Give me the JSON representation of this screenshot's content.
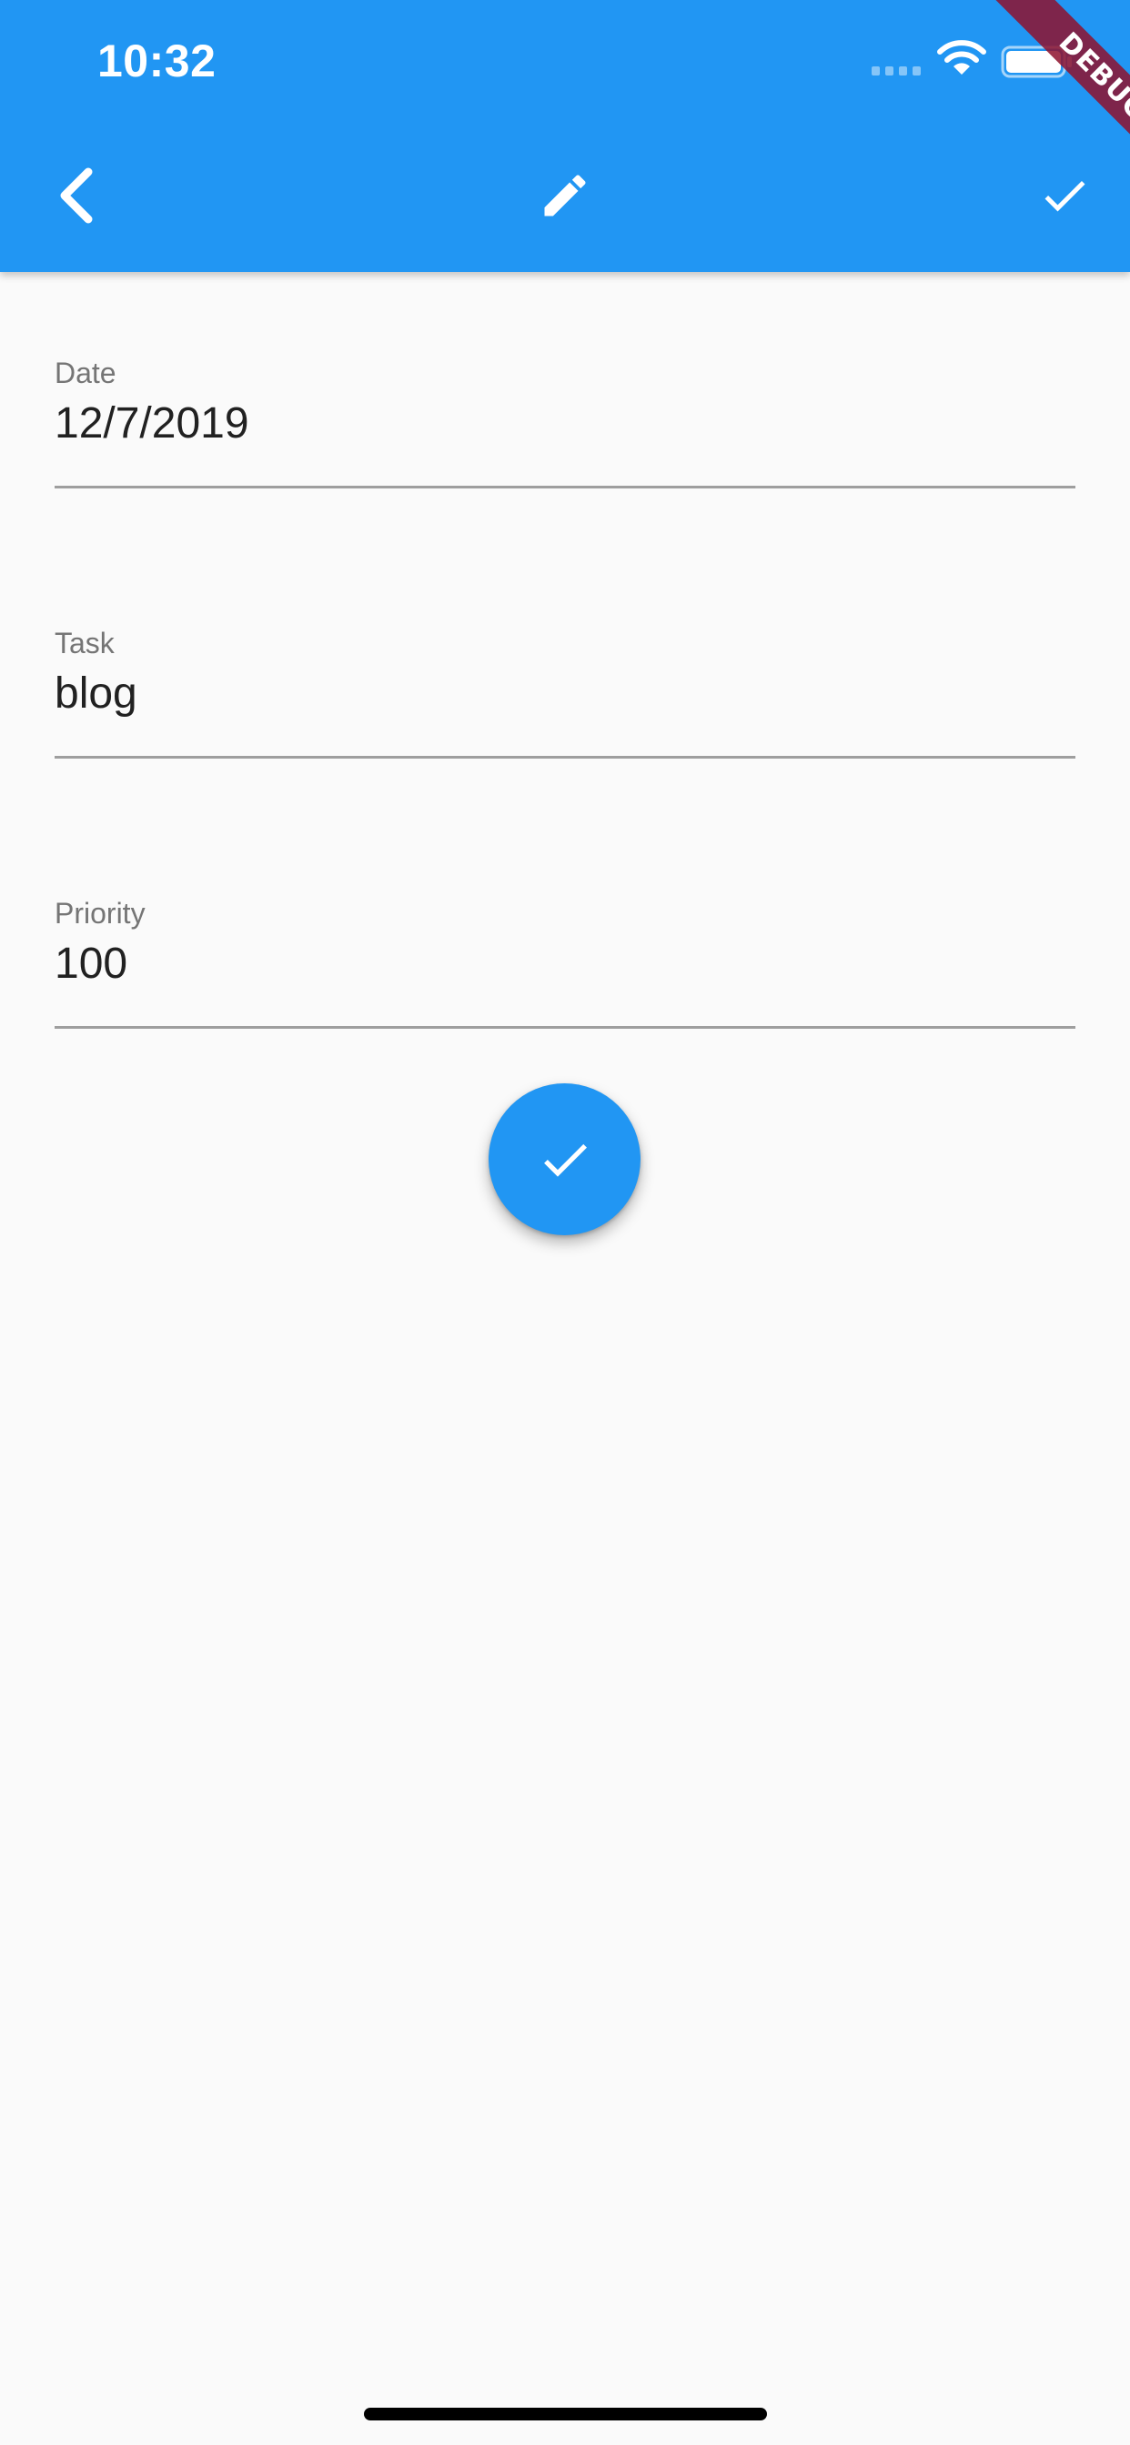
{
  "status_bar": {
    "time": "10:32"
  },
  "app_bar": {
    "back_icon": "chevron-left-icon",
    "title_icon": "pencil-icon",
    "action_icon": "check-icon",
    "background_color": "#2196f3"
  },
  "debug_banner": {
    "label": "DEBUG",
    "color": "#8e122d"
  },
  "form": {
    "fields": [
      {
        "label": "Date",
        "value": "12/7/2019"
      },
      {
        "label": "Task",
        "value": "blog"
      },
      {
        "label": "Priority",
        "value": "100"
      }
    ]
  },
  "fab": {
    "icon": "check-icon",
    "color": "#2196f3"
  },
  "colors": {
    "accent": "#2196f3",
    "background": "#fafafa",
    "label_text": "#757575",
    "value_text": "#212121",
    "underline": "#9e9e9e"
  }
}
